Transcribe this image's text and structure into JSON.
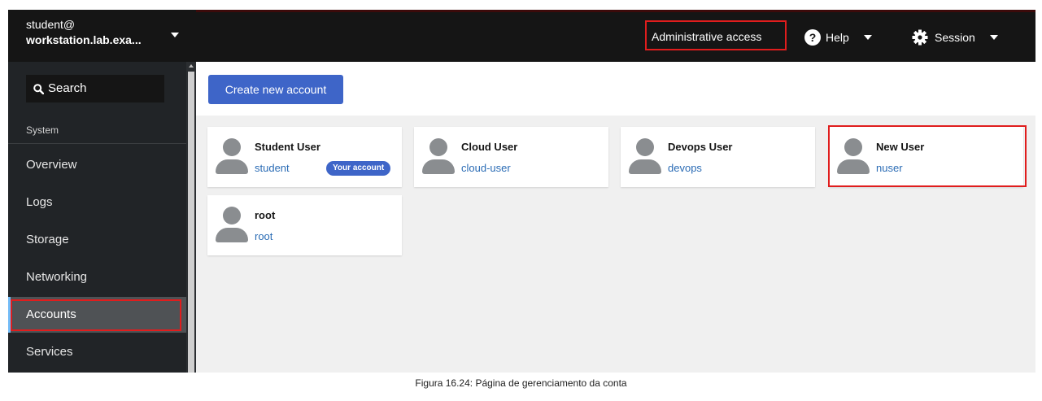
{
  "sidebar": {
    "host_line1": "student@",
    "host_line2": "workstation.lab.exa...",
    "search_label": "Search",
    "section_label": "System",
    "items": [
      {
        "label": "Overview"
      },
      {
        "label": "Logs"
      },
      {
        "label": "Storage"
      },
      {
        "label": "Networking"
      },
      {
        "label": "Accounts",
        "active": true
      },
      {
        "label": "Services"
      }
    ]
  },
  "topbar": {
    "admin_label": "Administrative access",
    "help_label": "Help",
    "session_label": "Session"
  },
  "main": {
    "create_button": "Create new account",
    "accounts": [
      {
        "name": "Student User",
        "login": "student",
        "badge": "Your account"
      },
      {
        "name": "Cloud User",
        "login": "cloud-user"
      },
      {
        "name": "Devops User",
        "login": "devops"
      },
      {
        "name": "New User",
        "login": "nuser"
      },
      {
        "name": "root",
        "login": "root"
      }
    ]
  },
  "caption": "Figura 16.24: Página de gerenciamento da conta",
  "colors": {
    "highlight": "#e01d1d",
    "accent": "#3e65c8",
    "link": "#2b6cb5",
    "sidebar_bg": "#212427",
    "topbar_bg": "#151515"
  },
  "icons": [
    "search-icon",
    "help-icon",
    "gear-icon",
    "chevron-down-icon",
    "avatar-icon"
  ]
}
